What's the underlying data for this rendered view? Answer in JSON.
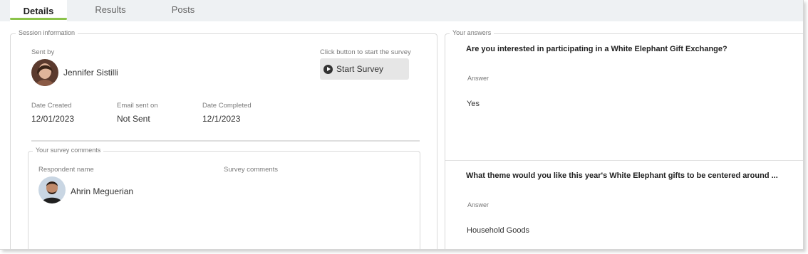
{
  "tabs": [
    {
      "label": "Details"
    },
    {
      "label": "Results"
    },
    {
      "label": "Posts"
    }
  ],
  "session": {
    "legend": "Session information",
    "sent_by_label": "Sent by",
    "sender_name": "Jennifer Sistilli",
    "start_hint": "Click button to start the survey",
    "start_button": "Start Survey",
    "date_created_label": "Date Created",
    "date_created": "12/01/2023",
    "email_sent_label": "Email sent on",
    "email_sent": "Not Sent",
    "date_completed_label": "Date Completed",
    "date_completed": "12/1/2023"
  },
  "comments": {
    "legend": "Your survey comments",
    "respondent_label": "Respondent name",
    "comments_label": "Survey comments",
    "respondent_name": "Ahrin Meguerian"
  },
  "answers": {
    "legend": "Your answers",
    "items": [
      {
        "question": "Are you interested in participating in a White Elephant Gift Exchange?",
        "answer_label": "Answer",
        "answer": "Yes"
      },
      {
        "question": "What theme would you like this year's White Elephant gifts to be centered around ...",
        "answer_label": "Answer",
        "answer": "Household Goods"
      }
    ]
  },
  "colors": {
    "accent": "#8bc34a",
    "tabbar": "#eef1f3",
    "button": "#e6e6e6"
  }
}
